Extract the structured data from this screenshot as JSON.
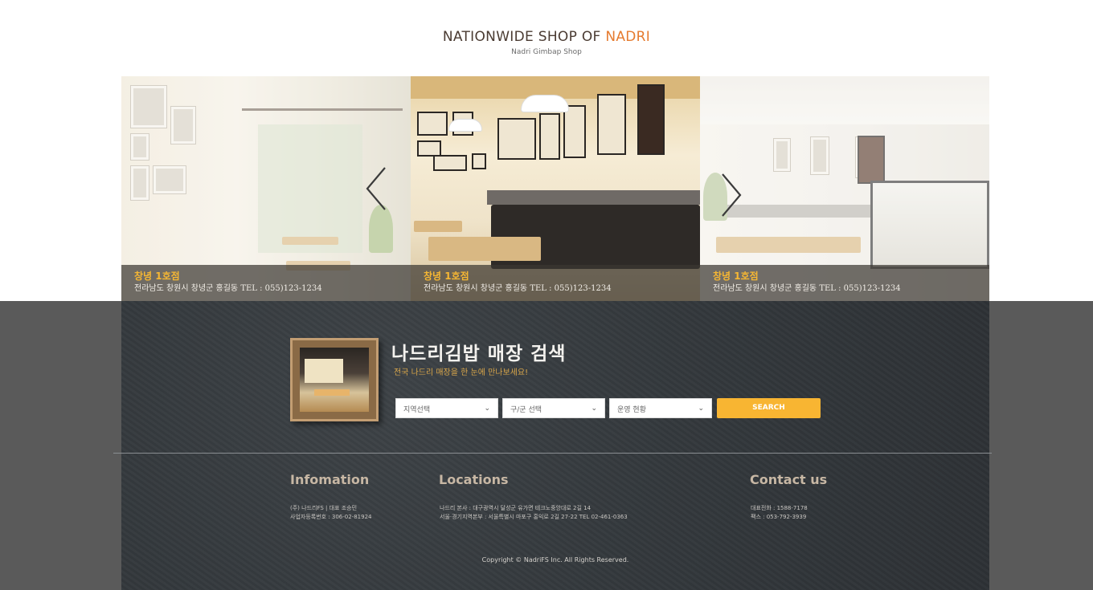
{
  "header": {
    "brand_main": "NATIONWIDE SHOP OF ",
    "brand_accent": "NADRI",
    "brand_sub": "Nadri Gimbap Shop"
  },
  "slider": {
    "slides": [
      {
        "title": "창녕 1호점",
        "address": "전라남도 창원시 창녕군 홍길동 TEL : 055)123-1234"
      },
      {
        "title": "창녕 1호점",
        "address": "전라남도 창원시 창녕군 홍길동 TEL : 055)123-1234"
      },
      {
        "title": "창녕 1호점",
        "address": "전라남도 창원시 창녕군 홍길동 TEL : 055)123-1234"
      }
    ]
  },
  "search": {
    "title": "나드리김밥 매장 검색",
    "subtitle": "전국 나드리 매장을 한 눈에 만나보세요!",
    "region_select": "지역선택",
    "district_select": "구/군 선택",
    "status_select": "운영 현황",
    "button": "SEARCH"
  },
  "footer": {
    "info_heading": "Infomation",
    "info_lines": [
      "(주) 나드리FS | 대표 조승민",
      "사업자등록번호 : 306-02-81924"
    ],
    "locations_heading": "Locations",
    "locations_lines": [
      "나드리 본사 : 대구광역시 달성군 유가면 테크노중앙대로 2길 14",
      "서울·경기지역본부 : 서울특별시 마포구 홍익로 2길 27-22   TEL 02-461-0363"
    ],
    "contact_heading": "Contact us",
    "contact_lines": [
      "대표전화 : 1588-7178",
      "팩스 : 053-792-3939"
    ],
    "copyright": "Copyright © NadriFS Inc. All Rights Reserved."
  }
}
